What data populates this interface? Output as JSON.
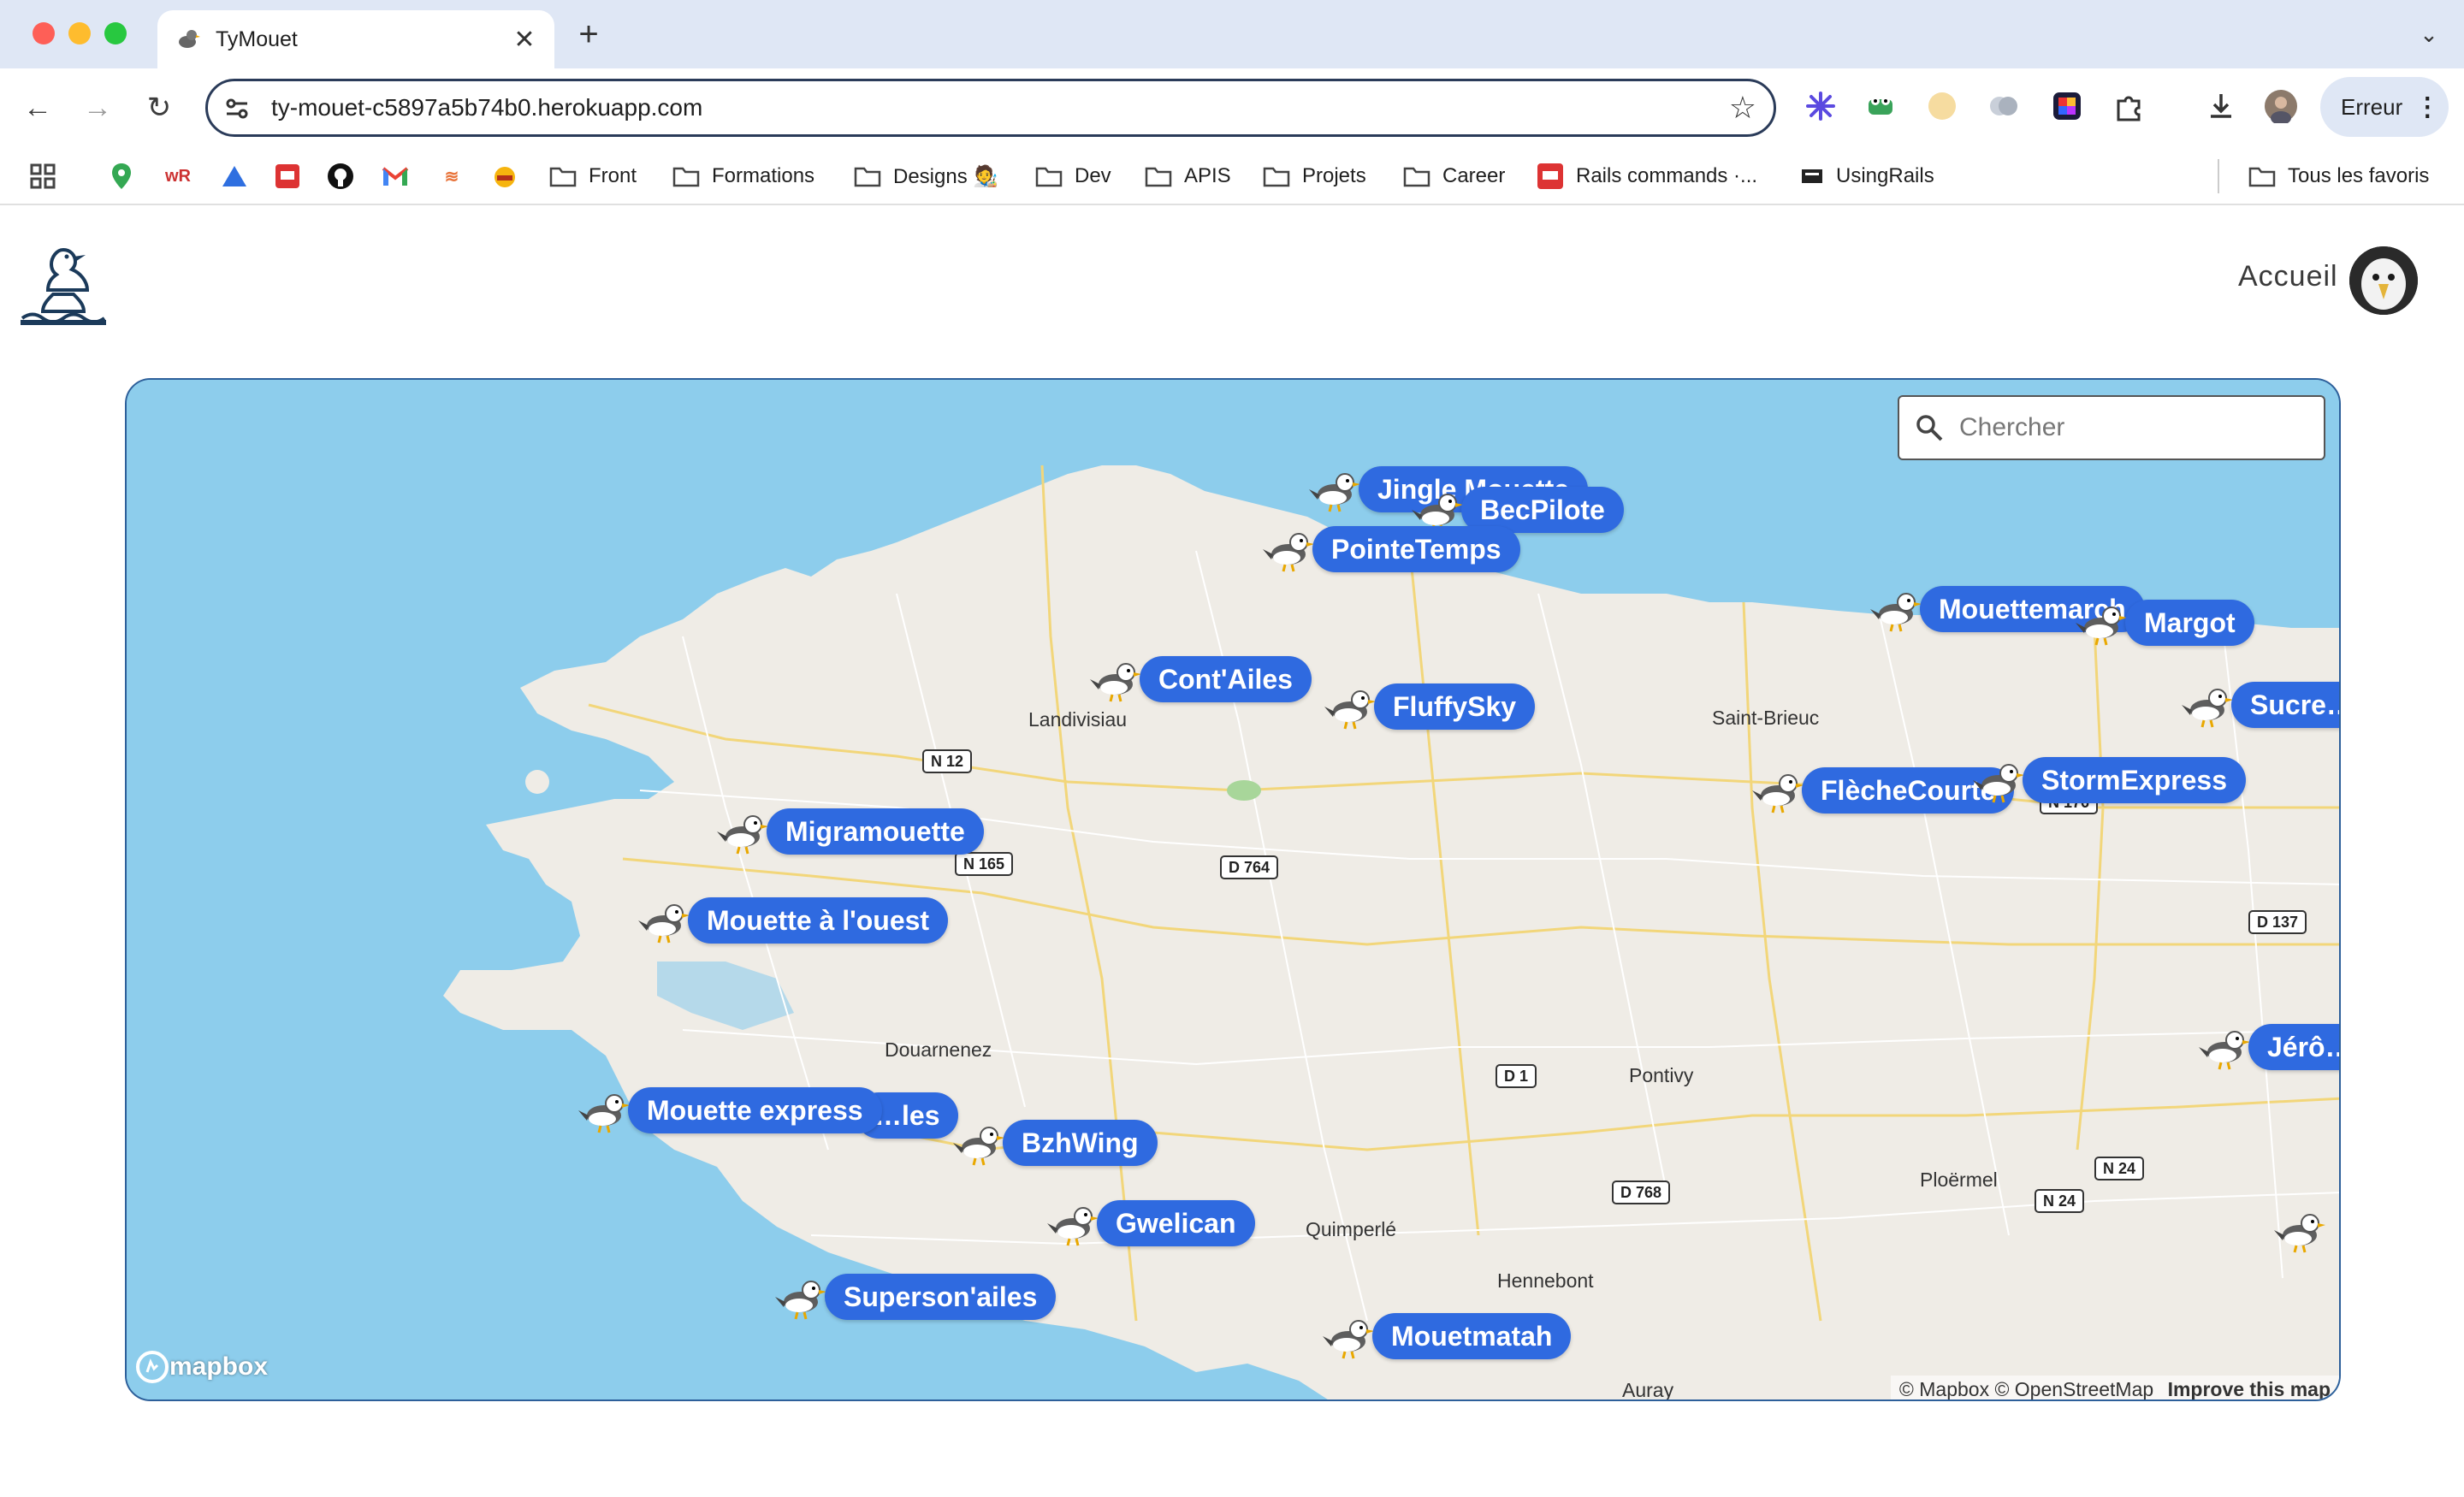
{
  "browser": {
    "tab_title": "TyMouet",
    "url": "ty-mouet-c5897a5b74b0.herokuapp.com",
    "profile_button": "Erreur",
    "bookmarks": [
      {
        "label": "Front"
      },
      {
        "label": "Formations"
      },
      {
        "label": "Designs 🧑‍🎨"
      },
      {
        "label": "Dev"
      },
      {
        "label": "APIS"
      },
      {
        "label": "Projets"
      },
      {
        "label": "Career"
      },
      {
        "label": "Rails commands ·..."
      },
      {
        "label": "UsingRails"
      },
      {
        "label": "Tous les favoris"
      }
    ]
  },
  "header": {
    "nav_home": "Accueil"
  },
  "map": {
    "search_placeholder": "Chercher",
    "markers": [
      "Jingle Mouette",
      "BecPilote",
      "PointeTemps",
      "Cont'Ailes",
      "FluffySky",
      "Migramouette",
      "Mouette à l'ouest",
      "…les",
      "Mouette express",
      "BzhWing",
      "Gwelican",
      "Superson'ailes",
      "Mouetmatah",
      "Mouettemarch",
      "Margot",
      "Sucre…",
      "FlècheCourte",
      "StormExpress",
      "Jérô…"
    ],
    "towns": [
      "Landivisiau",
      "Saint-Brieuc",
      "Douarnenez",
      "Pontivy",
      "Quimperlé",
      "Hennebont",
      "Ploërmel",
      "Auray"
    ],
    "roads": [
      "N 12",
      "N 165",
      "D 764",
      "N 176",
      "D 137",
      "D 1",
      "D 768",
      "N 24",
      "N 24"
    ],
    "brand": "mapbox",
    "attribution": "© Mapbox © OpenStreetMap",
    "improve_link": "Improve this map"
  }
}
